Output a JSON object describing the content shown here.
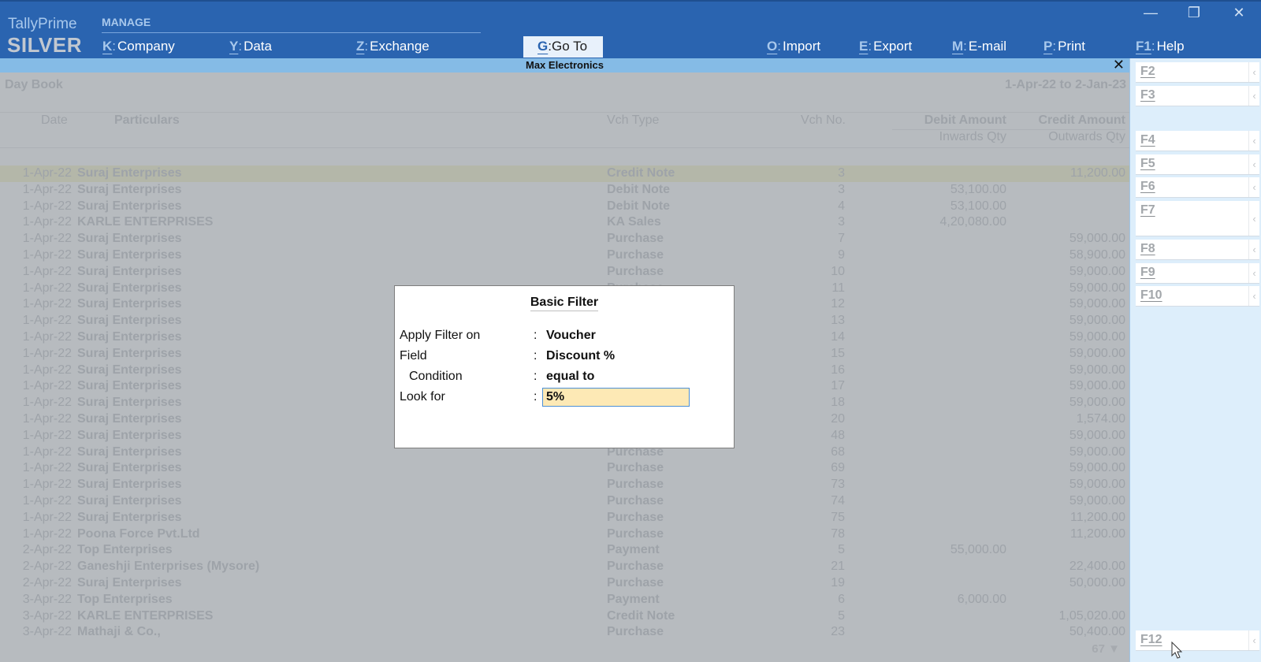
{
  "app": {
    "brand_line1": "TallyPrime",
    "brand_line2": "SILVER",
    "section_label": "MANAGE"
  },
  "menu": {
    "company": {
      "key": "K",
      "label": "Company"
    },
    "data": {
      "key": "Y",
      "label": "Data"
    },
    "exchange": {
      "key": "Z",
      "label": "Exchange"
    },
    "goto": {
      "key": "G",
      "label": "Go To"
    },
    "import": {
      "key": "O",
      "label": "Import"
    },
    "export": {
      "key": "E",
      "label": "Export"
    },
    "email": {
      "key": "M",
      "label": "E-mail"
    },
    "print": {
      "key": "P",
      "label": "Print"
    },
    "help": {
      "key": "F1",
      "label": "Help"
    }
  },
  "window_controls": {
    "minimize": "—",
    "restore": "❐",
    "close": "✕"
  },
  "titlebar": {
    "company": "Max Electronics",
    "close": "✕"
  },
  "report": {
    "title": "Day Book",
    "period": "1-Apr-22 to 2-Jan-23",
    "columns": {
      "date": "Date",
      "particulars": "Particulars",
      "vch_type": "Vch Type",
      "vch_no": "Vch No.",
      "debit": "Debit Amount",
      "credit": "Credit Amount",
      "inwards": "Inwards Qty",
      "outwards": "Outwards Qty"
    },
    "rows": [
      {
        "date": "1-Apr-22",
        "particulars": "Suraj Enterprises",
        "type": "Credit Note",
        "no": "3",
        "debit": "",
        "credit": "11,200.00"
      },
      {
        "date": "1-Apr-22",
        "particulars": "Suraj Enterprises",
        "type": "Debit Note",
        "no": "3",
        "debit": "53,100.00",
        "credit": ""
      },
      {
        "date": "1-Apr-22",
        "particulars": "Suraj Enterprises",
        "type": "Debit Note",
        "no": "4",
        "debit": "53,100.00",
        "credit": ""
      },
      {
        "date": "1-Apr-22",
        "particulars": "KARLE ENTERPRISES",
        "type": "KA Sales",
        "no": "3",
        "debit": "4,20,080.00",
        "credit": ""
      },
      {
        "date": "1-Apr-22",
        "particulars": "Suraj Enterprises",
        "type": "Purchase",
        "no": "7",
        "debit": "",
        "credit": "59,000.00"
      },
      {
        "date": "1-Apr-22",
        "particulars": "Suraj Enterprises",
        "type": "Purchase",
        "no": "9",
        "debit": "",
        "credit": "58,900.00"
      },
      {
        "date": "1-Apr-22",
        "particulars": "Suraj Enterprises",
        "type": "Purchase",
        "no": "10",
        "debit": "",
        "credit": "59,000.00"
      },
      {
        "date": "1-Apr-22",
        "particulars": "Suraj Enterprises",
        "type": "Purchase",
        "no": "11",
        "debit": "",
        "credit": "59,000.00"
      },
      {
        "date": "1-Apr-22",
        "particulars": "Suraj Enterprises",
        "type": "",
        "no": "12",
        "debit": "",
        "credit": "59,000.00"
      },
      {
        "date": "1-Apr-22",
        "particulars": "Suraj Enterprises",
        "type": "",
        "no": "13",
        "debit": "",
        "credit": "59,000.00"
      },
      {
        "date": "1-Apr-22",
        "particulars": "Suraj Enterprises",
        "type": "",
        "no": "14",
        "debit": "",
        "credit": "59,000.00"
      },
      {
        "date": "1-Apr-22",
        "particulars": "Suraj Enterprises",
        "type": "",
        "no": "15",
        "debit": "",
        "credit": "59,000.00"
      },
      {
        "date": "1-Apr-22",
        "particulars": "Suraj Enterprises",
        "type": "",
        "no": "16",
        "debit": "",
        "credit": "59,000.00"
      },
      {
        "date": "1-Apr-22",
        "particulars": "Suraj Enterprises",
        "type": "",
        "no": "17",
        "debit": "",
        "credit": "59,000.00"
      },
      {
        "date": "1-Apr-22",
        "particulars": "Suraj Enterprises",
        "type": "",
        "no": "18",
        "debit": "",
        "credit": "59,000.00"
      },
      {
        "date": "1-Apr-22",
        "particulars": "Suraj Enterprises",
        "type": "",
        "no": "20",
        "debit": "",
        "credit": "1,574.00"
      },
      {
        "date": "1-Apr-22",
        "particulars": "Suraj Enterprises",
        "type": "",
        "no": "48",
        "debit": "",
        "credit": "59,000.00"
      },
      {
        "date": "1-Apr-22",
        "particulars": "Suraj Enterprises",
        "type": "Purchase",
        "no": "68",
        "debit": "",
        "credit": "59,000.00"
      },
      {
        "date": "1-Apr-22",
        "particulars": "Suraj Enterprises",
        "type": "Purchase",
        "no": "69",
        "debit": "",
        "credit": "59,000.00"
      },
      {
        "date": "1-Apr-22",
        "particulars": "Suraj Enterprises",
        "type": "Purchase",
        "no": "73",
        "debit": "",
        "credit": "59,000.00"
      },
      {
        "date": "1-Apr-22",
        "particulars": "Suraj Enterprises",
        "type": "Purchase",
        "no": "74",
        "debit": "",
        "credit": "59,000.00"
      },
      {
        "date": "1-Apr-22",
        "particulars": "Suraj Enterprises",
        "type": "Purchase",
        "no": "75",
        "debit": "",
        "credit": "11,200.00"
      },
      {
        "date": "1-Apr-22",
        "particulars": "Poona Force Pvt.Ltd",
        "type": "Purchase",
        "no": "78",
        "debit": "",
        "credit": "11,200.00"
      },
      {
        "date": "2-Apr-22",
        "particulars": "Top Enterprises",
        "type": "Payment",
        "no": "5",
        "debit": "55,000.00",
        "credit": ""
      },
      {
        "date": "2-Apr-22",
        "particulars": "Ganeshji Enterprises (Mysore)",
        "type": "Purchase",
        "no": "21",
        "debit": "",
        "credit": "22,400.00"
      },
      {
        "date": "2-Apr-22",
        "particulars": "Suraj Enterprises",
        "type": "Purchase",
        "no": "19",
        "debit": "",
        "credit": "50,000.00"
      },
      {
        "date": "3-Apr-22",
        "particulars": "Top Enterprises",
        "type": "Payment",
        "no": "6",
        "debit": "6,000.00",
        "credit": ""
      },
      {
        "date": "3-Apr-22",
        "particulars": "KARLE ENTERPRISES",
        "type": "Credit Note",
        "no": "5",
        "debit": "",
        "credit": "1,05,020.00"
      },
      {
        "date": "3-Apr-22",
        "particulars": "Mathaji & Co.,",
        "type": "Purchase",
        "no": "23",
        "debit": "",
        "credit": "50,400.00"
      }
    ],
    "more_indicator": "67 ▼"
  },
  "right_panel": {
    "keys": [
      {
        "label": "F2"
      },
      {
        "label": "F3"
      },
      {
        "label": "F4"
      },
      {
        "label": "F5"
      },
      {
        "label": "F6"
      },
      {
        "label": "F7"
      },
      {
        "label": "F8"
      },
      {
        "label": "F9"
      },
      {
        "label": "F10"
      },
      {
        "label": "F12"
      }
    ],
    "arrow": "‹"
  },
  "dialog": {
    "title": "Basic Filter",
    "apply_filter_label": "Apply Filter on",
    "apply_filter_value": "Voucher",
    "field_label": "Field",
    "field_value": "Discount %",
    "condition_label": "Condition",
    "condition_value": "equal to",
    "look_for_label": "Look for",
    "look_for_value": "5%",
    "colon": ":"
  }
}
